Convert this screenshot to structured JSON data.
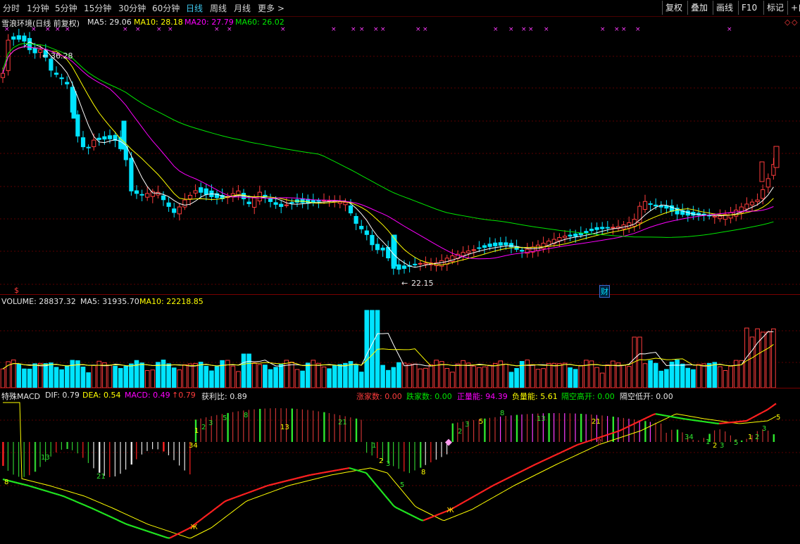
{
  "toolbar": {
    "periods": [
      {
        "label": "分时",
        "active": false
      },
      {
        "label": "1分钟",
        "active": false
      },
      {
        "label": "5分钟",
        "active": false
      },
      {
        "label": "15分钟",
        "active": false
      },
      {
        "label": "30分钟",
        "active": false
      },
      {
        "label": "60分钟",
        "active": false
      },
      {
        "label": "日线",
        "active": true
      },
      {
        "label": "周线",
        "active": false
      },
      {
        "label": "月线",
        "active": false
      },
      {
        "label": "更多 >",
        "active": false
      }
    ],
    "buttons": [
      "复权",
      "叠加",
      "画线",
      "F10",
      "标记",
      "+自"
    ]
  },
  "price_panel": {
    "title": "雪浪环境(日线 前复权)",
    "ma5": "MA5: 29.06",
    "ma10": "MA10: 28.18",
    "ma20": "MA20: 27.79",
    "ma60": "MA60: 26.02",
    "high_label": "36.28",
    "low_label": "22.15",
    "marker_left": "$",
    "marker_fin": "财"
  },
  "volume_panel": {
    "volume": "VOLUME: 28837.32",
    "ma5": "MA5: 31935.70",
    "ma10": "MA10: 22218.85"
  },
  "macd_panel": {
    "title": "特殊MACD",
    "dif": "DIF: 0.79",
    "dea": "DEA: 0.54",
    "macd": "MACD: 0.49",
    "macd_arrow": "↑0.79",
    "profit": "获利比: 0.89",
    "zhang": "涨家数: 0.00",
    "die": "跌家数: 0.00",
    "zheng": "正量能: 94.39",
    "fu": "负量能: 5.61",
    "gkgk": "隔空高开: 0.00",
    "gkdk": "隔空低开: 0.00",
    "bar_labels": [
      "8",
      "13",
      "21",
      "1",
      "2",
      "3",
      "34",
      "5",
      "8",
      "13",
      "21",
      "1",
      "2",
      "3",
      "5",
      "8",
      "2",
      "3",
      "5",
      "8",
      "13",
      "21",
      "34",
      "1",
      "2",
      "3",
      "5",
      "1",
      "2",
      "3",
      "5"
    ]
  },
  "colors": {
    "up": "#ff3c3c",
    "down": "#00e4ff",
    "ma5": "#ffffff",
    "ma10": "#ffff00",
    "ma20": "#ff00ff",
    "ma60": "#00e600"
  }
}
